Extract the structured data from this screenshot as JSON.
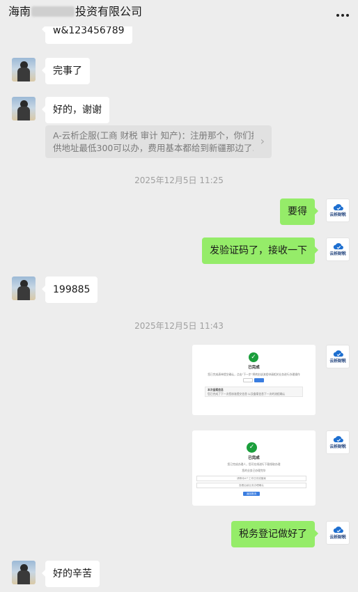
{
  "header": {
    "title_prefix": "海南",
    "title_suffix": "投资有限公司",
    "more_icon": "more-icon"
  },
  "messages": {
    "m0_partial": "w&123456789",
    "m1": "完事了",
    "m2": "好的，谢谢",
    "quote_line1": "A-云析企服(工商 财税 审计 知产)：注册那个，你们提",
    "quote_line2": "供地址最低300可以办，费用基本都给到新疆那边了...",
    "time1": "2025年12月5日 11:25",
    "m3": "要得",
    "m4": "发验证码了，接收一下",
    "m5": "199885",
    "time2": "2025年12月5日 11:43",
    "img1": {
      "status": "已完成",
      "desc": "您已完成表单提交确认，点击\"下一步\"将转由该流程申请相关业务进行办理操作",
      "note": "本次备案信息",
      "detail": "您已完成了下一次您核准提交信息 以及备案信息下一次的流程确认"
    },
    "img2": {
      "status": "已完成",
      "desc": "您已完成办理人，您可在线进行下载领取办理",
      "rows": [
        "您的业务已办理完毕",
        "请等待4个工作日完成备案",
        "查看后续业务办理确认"
      ],
      "button": "返回首页"
    },
    "m6": "税务登记做好了",
    "m7": "好的辛苦"
  },
  "brand_avatar": {
    "label": "云析财税",
    "icon": "cloud-icon"
  },
  "colors": {
    "background": "#ededed",
    "outgoing_bubble": "#95ec69",
    "incoming_bubble": "#ffffff",
    "success": "#1a9e3b"
  }
}
